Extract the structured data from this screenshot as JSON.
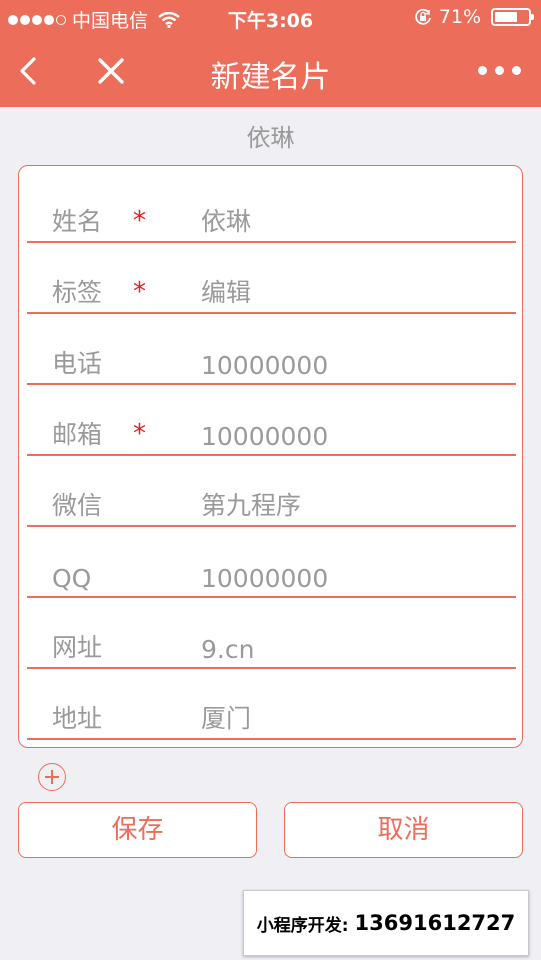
{
  "status_bar": {
    "carrier": "中国电信",
    "time": "下午3:06",
    "battery_percent": "71%",
    "battery_level": 0.71,
    "icons": [
      "signal-dots-icon",
      "wifi-icon",
      "orientation-lock-icon",
      "battery-icon"
    ]
  },
  "nav": {
    "title": "新建名片",
    "icons": [
      "back-arrow-icon",
      "close-icon",
      "more-icon"
    ]
  },
  "name_heading": "依琳",
  "form": {
    "rows": [
      {
        "label": "姓名",
        "required": true,
        "star": "*",
        "value": "依琳"
      },
      {
        "label": "标签",
        "required": true,
        "star": "*",
        "value": "编辑"
      },
      {
        "label": "电话",
        "required": false,
        "value": "10000000"
      },
      {
        "label": "邮箱",
        "required": true,
        "star": "*",
        "value": "10000000"
      },
      {
        "label": "微信",
        "required": false,
        "value": "第九程序"
      },
      {
        "label": "QQ",
        "required": false,
        "value": "10000000"
      },
      {
        "label": "网址",
        "required": false,
        "value": "9.cn"
      },
      {
        "label": "地址",
        "required": false,
        "value": "厦门"
      }
    ]
  },
  "actions": {
    "add_icon": "plus-circle-icon",
    "save_label": "保存",
    "cancel_label": "取消"
  },
  "promo": {
    "prefix": "小程序开发:",
    "phone": "13691612727"
  },
  "colors": {
    "accent": "#ec6d5a",
    "required_star": "#e02020",
    "muted_text": "#9a9a9a",
    "background": "#efeff4"
  }
}
